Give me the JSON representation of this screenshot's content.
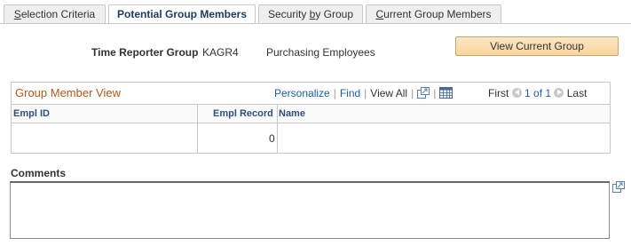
{
  "tabs": [
    {
      "label": "Selection Criteria",
      "underline": "S",
      "rest": "election Criteria"
    },
    {
      "label": "Potential Group Members"
    },
    {
      "label": "Security by Group",
      "pre": "Security ",
      "underline": "b",
      "rest": "y Group"
    },
    {
      "label": "Current Group Members",
      "underline": "C",
      "rest": "urrent Group Members"
    }
  ],
  "header": {
    "label": "Time Reporter Group",
    "code": "KAGR4",
    "description": "Purchasing Employees",
    "view_button": "View Current Group"
  },
  "grid": {
    "title": "Group Member View",
    "personalize": "Personalize",
    "find": "Find",
    "view_all": "View All",
    "first": "First",
    "range": "1 of 1",
    "last": "Last",
    "columns": [
      "Empl ID",
      "Empl Record",
      "Name"
    ],
    "rows": [
      {
        "empl_id": "",
        "empl_record": "0",
        "name": ""
      }
    ]
  },
  "comments": {
    "label": "Comments",
    "value": ""
  },
  "icons": {
    "new_window": "new-window-icon",
    "spreadsheet": "download-spreadsheet-icon",
    "prev": "previous-row-icon",
    "next": "next-row-icon",
    "expand": "expand-text-icon"
  },
  "colors": {
    "link": "#1a5ea8",
    "grid_title": "#b05a1a",
    "button_bg": "#f9d59d"
  }
}
